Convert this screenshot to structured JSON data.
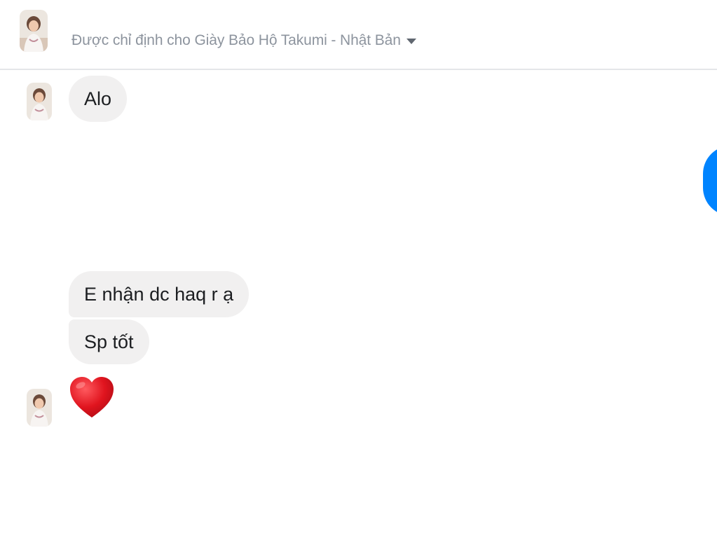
{
  "header": {
    "assigned_to": "Được chỉ định cho Giày Bảo Hộ Takumi - Nhật Bản",
    "dropdown_icon": "caret-down-icon"
  },
  "conversation": {
    "messages": [
      {
        "direction": "incoming",
        "text": "Alo"
      },
      {
        "direction": "outgoing",
        "text": ""
      },
      {
        "direction": "incoming",
        "text": "E nhận dc haq r ạ"
      },
      {
        "direction": "incoming",
        "text": "Sp tốt"
      },
      {
        "direction": "incoming",
        "type": "emoji",
        "emoji": "heart-icon"
      }
    ]
  },
  "colors": {
    "incoming_bubble": "#f1f0f0",
    "outgoing_bubble": "#0084ff",
    "heart": "#e0141e",
    "header_text": "#8d949e"
  }
}
